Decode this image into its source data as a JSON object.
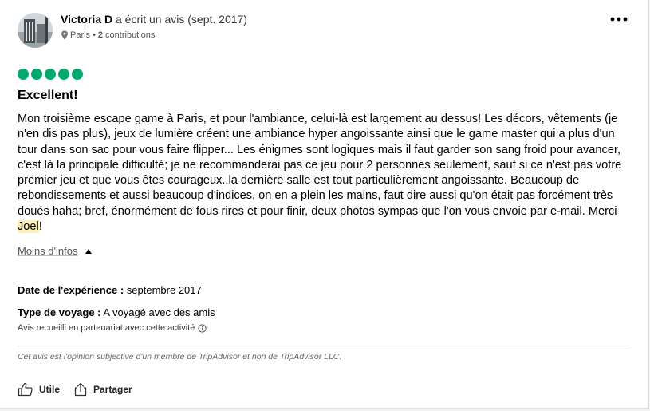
{
  "review": {
    "author": {
      "name": "Victoria D",
      "action_text": "a écrit un avis (sept. 2017)",
      "location": "Paris",
      "separator": "•",
      "contributions_count": "2",
      "contributions_label": "contributions"
    },
    "more_menu_icon": "three-dots-icon",
    "rating": {
      "value": 5,
      "max": 5,
      "color": "#00aa6c"
    },
    "title": "Excellent!",
    "body_before_highlight": "Mon troisième escape game à Paris, et pour l'ambiance, celui-là est largement au dessus! Les décors, vêtements (je n'en dis pas plus), jeux de lumière créent une ambiance hyper angoissante ainsi que le game master qui a plus d'un tour dans son sac pour vous faire flipper... Les énigmes sont logiques mais il faut garder son sang froid pour avancer, c'est là la principale difficulté; je ne recommanderai pas ce jeu pour 2 personnes seulement, sauf si ce n'est pas votre premier jeu et que vous êtes courageux..la dernière salle est tout particulièrement angoissante. Beaucoup de rebondissements et aussi beaucoup d'indices, on en a plein les mains, faut dire aussi qu'on était pas forcément très doués haha; bref, énormément de fous rires et pour finir, deux photos sympas que l'on vous envoie par e-mail. Merci ",
    "body_highlight": "Joel",
    "body_after_highlight": "!",
    "highlight_color": "#fdf0bf",
    "show_less_label": "Moins d'infos",
    "experience_date_label": "Date de l'expérience :",
    "experience_date_value": "septembre 2017",
    "trip_type_label": "Type de voyage :",
    "trip_type_value": "A voyagé avec des amis",
    "partner_note": "Avis recueilli en partenariat avec cette activité",
    "disclaimer": "Cet avis est l'opinion subjective d'un membre de TripAdvisor et non de TripAdvisor LLC.",
    "actions": {
      "helpful_label": "Utile",
      "share_label": "Partager"
    }
  }
}
